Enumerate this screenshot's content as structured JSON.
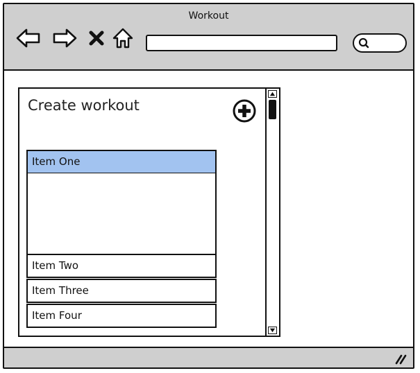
{
  "window": {
    "title": "Workout"
  },
  "toolbar": {
    "back_icon": "back-arrow-icon",
    "forward_icon": "forward-arrow-icon",
    "stop_icon": "close-icon",
    "home_icon": "home-icon",
    "url_value": "",
    "search_icon": "search-icon"
  },
  "panel": {
    "title": "Create workout",
    "add_icon": "plus-circle-icon"
  },
  "list": {
    "items": [
      {
        "label": "Item One",
        "selected": true
      },
      {
        "label": "Item Two",
        "selected": false
      },
      {
        "label": "Item Three",
        "selected": false
      },
      {
        "label": "Item Four",
        "selected": false
      }
    ]
  },
  "colors": {
    "selected_item": "#a2c3f0",
    "chrome": "#cfcfcf"
  }
}
